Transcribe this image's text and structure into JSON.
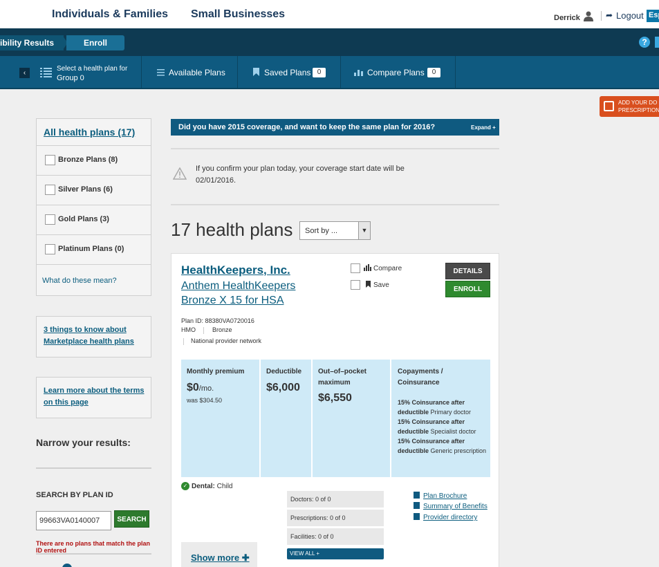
{
  "header": {
    "nav_individuals": "Individuals & Families",
    "nav_small_business": "Small Businesses",
    "user_name": "Derrick",
    "logout": "Logout",
    "language": "Esp"
  },
  "breadcrumb": {
    "step1": "ibility Results",
    "step2": "Enroll"
  },
  "subnav": {
    "select_line1": "Select a health plan for",
    "select_line2": "Group 0",
    "available_plans": "Available Plans",
    "saved_plans": "Saved Plans",
    "saved_count": "0",
    "compare_plans": "Compare Plans",
    "compare_count": "0"
  },
  "rx_badge": {
    "line1": "ADD YOUR DO",
    "line2": "PRESCRIPTION"
  },
  "filters": {
    "all": "All health plans (17)",
    "items": [
      {
        "label": "Bronze Plans (8)"
      },
      {
        "label": "Silver Plans (6)"
      },
      {
        "label": "Gold Plans (3)"
      },
      {
        "label": "Platinum Plans (0)"
      }
    ],
    "meaning_link": "What do these mean?"
  },
  "sidebar": {
    "things_link": "3 things to know about Marketplace health plans",
    "terms_link": "Learn more about the terms on this page",
    "narrow": "Narrow your results:",
    "search_label": "SEARCH BY PLAN ID",
    "search_value": "99663VA0140007",
    "search_button": "SEARCH",
    "error": "There are no plans that match the plan ID entered"
  },
  "main": {
    "banner_question": "Did you have 2015 coverage, and want to keep the same plan for 2016?",
    "banner_expand": "Expand +",
    "notice": "If you confirm your plan today, your coverage start date will be 02/01/2016.",
    "plan_count": "17 health plans",
    "sort_placeholder": "Sort by ..."
  },
  "plan": {
    "issuer": "HealthKeepers, Inc.",
    "name": "Anthem HealthKeepers Bronze X 15 for HSA",
    "compare_label": "Compare",
    "save_label": "Save",
    "details_button": "DETAILS",
    "enroll_button": "ENROLL",
    "plan_id": "Plan ID: 88380VA0720016",
    "type": "HMO",
    "metal": "Bronze",
    "network": "National provider network",
    "premium_label": "Monthly premium",
    "premium_value": "$0",
    "premium_unit": "/mo.",
    "premium_was": "was $304.50",
    "deductible_label": "Deductible",
    "deductible_value": "$6,000",
    "oop_label": "Out–of–pocket maximum",
    "oop_value": "$6,550",
    "copay_label": "Copayments / Coinsurance",
    "copay1_bold": "15% Coinsurance after deductible",
    "copay1_rest": " Primary doctor",
    "copay2_bold": "15% Coinsurance after deductible",
    "copay2_rest": " Specialist doctor",
    "copay3_bold": "15% Coinsurance after deductible",
    "copay3_rest": " Generic prescription",
    "dental_label": "Dental:",
    "dental_value": " Child",
    "doctors": "Doctors: 0 of 0",
    "prescriptions": "Prescriptions: 0 of 0",
    "facilities": "Facilities: 0 of 0",
    "view_all": "VIEW ALL +",
    "brochure": "Plan Brochure",
    "summary": "Summary of Benefits",
    "directory": "Provider directory",
    "show_more": "Show more"
  }
}
